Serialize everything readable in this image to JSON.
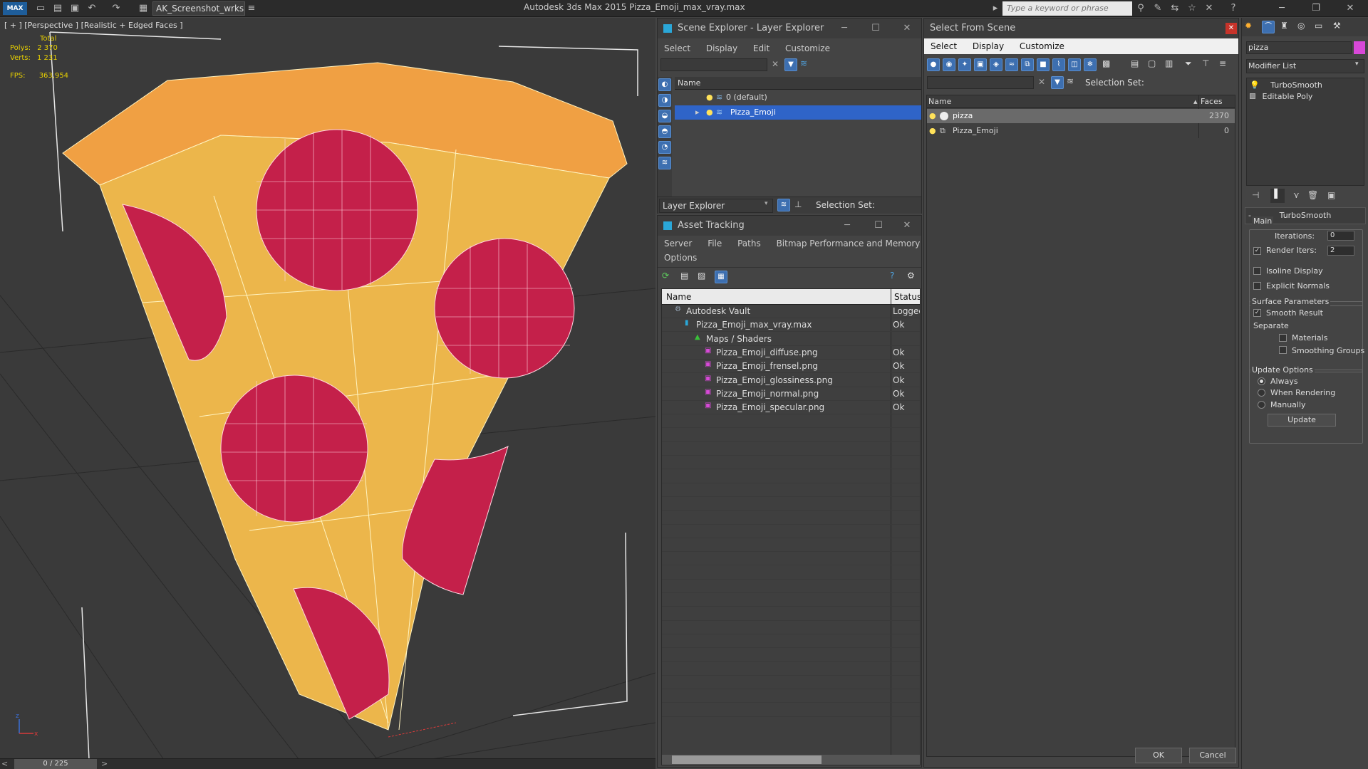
{
  "app": {
    "title": "Autodesk 3ds Max  2015    Pizza_Emoji_max_vray.max",
    "file_dropdown": "AK_Screenshot_wrksp",
    "keyword_placeholder": "Type a keyword or phrase"
  },
  "viewport": {
    "label": "[ + ] [Perspective ] [Realistic + Edged Faces ]",
    "stats": {
      "total_label": "Total",
      "polys_label": "Polys:",
      "polys_value": "2 370",
      "verts_label": "Verts:",
      "verts_value": "1 231",
      "fps_label": "FPS:",
      "fps_value": "363,954"
    },
    "timeline": "0 / 225"
  },
  "layer_explorer": {
    "title": "Scene Explorer - Layer Explorer",
    "menu": [
      "Select",
      "Display",
      "Edit",
      "Customize"
    ],
    "col_name": "Name",
    "rows": [
      "0 (default)",
      "Pizza_Emoji"
    ],
    "footer_label": "Layer Explorer",
    "selection_set": "Selection Set:"
  },
  "asset_tracking": {
    "title": "Asset Tracking",
    "menu": [
      "Server",
      "File",
      "Paths",
      "Bitmap Performance and Memory",
      "Options"
    ],
    "col_name": "Name",
    "col_status": "Status",
    "rows": [
      {
        "name": "Autodesk Vault",
        "status": "Logged",
        "indent": 0
      },
      {
        "name": "Pizza_Emoji_max_vray.max",
        "status": "Ok",
        "indent": 1
      },
      {
        "name": "Maps / Shaders",
        "status": "",
        "indent": 2
      },
      {
        "name": "Pizza_Emoji_diffuse.png",
        "status": "Ok",
        "indent": 3
      },
      {
        "name": "Pizza_Emoji_frensel.png",
        "status": "Ok",
        "indent": 3
      },
      {
        "name": "Pizza_Emoji_glossiness.png",
        "status": "Ok",
        "indent": 3
      },
      {
        "name": "Pizza_Emoji_normal.png",
        "status": "Ok",
        "indent": 3
      },
      {
        "name": "Pizza_Emoji_specular.png",
        "status": "Ok",
        "indent": 3
      }
    ]
  },
  "select_from_scene": {
    "title": "Select From Scene",
    "menu": [
      "Select",
      "Display",
      "Customize"
    ],
    "selection_set": "Selection Set:",
    "col_name": "Name",
    "col_faces": "Faces",
    "rows": [
      {
        "name": "pizza",
        "faces": "2370"
      },
      {
        "name": "Pizza_Emoji",
        "faces": "0"
      }
    ],
    "ok": "OK",
    "cancel": "Cancel"
  },
  "command_panel": {
    "search_value": "pizza",
    "modifier_list": "Modifier List",
    "stack": [
      "TurboSmooth",
      "Editable Poly"
    ],
    "rollout_title": "TurboSmooth",
    "main_label": "Main",
    "iterations_label": "Iterations:",
    "iterations_value": "0",
    "render_iters_label": "Render Iters:",
    "render_iters_value": "2",
    "isoline_label": "Isoline Display",
    "explicit_normals_label": "Explicit Normals",
    "surface_label": "Surface Parameters",
    "smooth_result_label": "Smooth Result",
    "separate_label": "Separate",
    "materials_label": "Materials",
    "smoothing_groups_label": "Smoothing Groups",
    "update_options_label": "Update Options",
    "always_label": "Always",
    "when_rendering_label": "When Rendering",
    "manually_label": "Manually",
    "update_button": "Update"
  }
}
